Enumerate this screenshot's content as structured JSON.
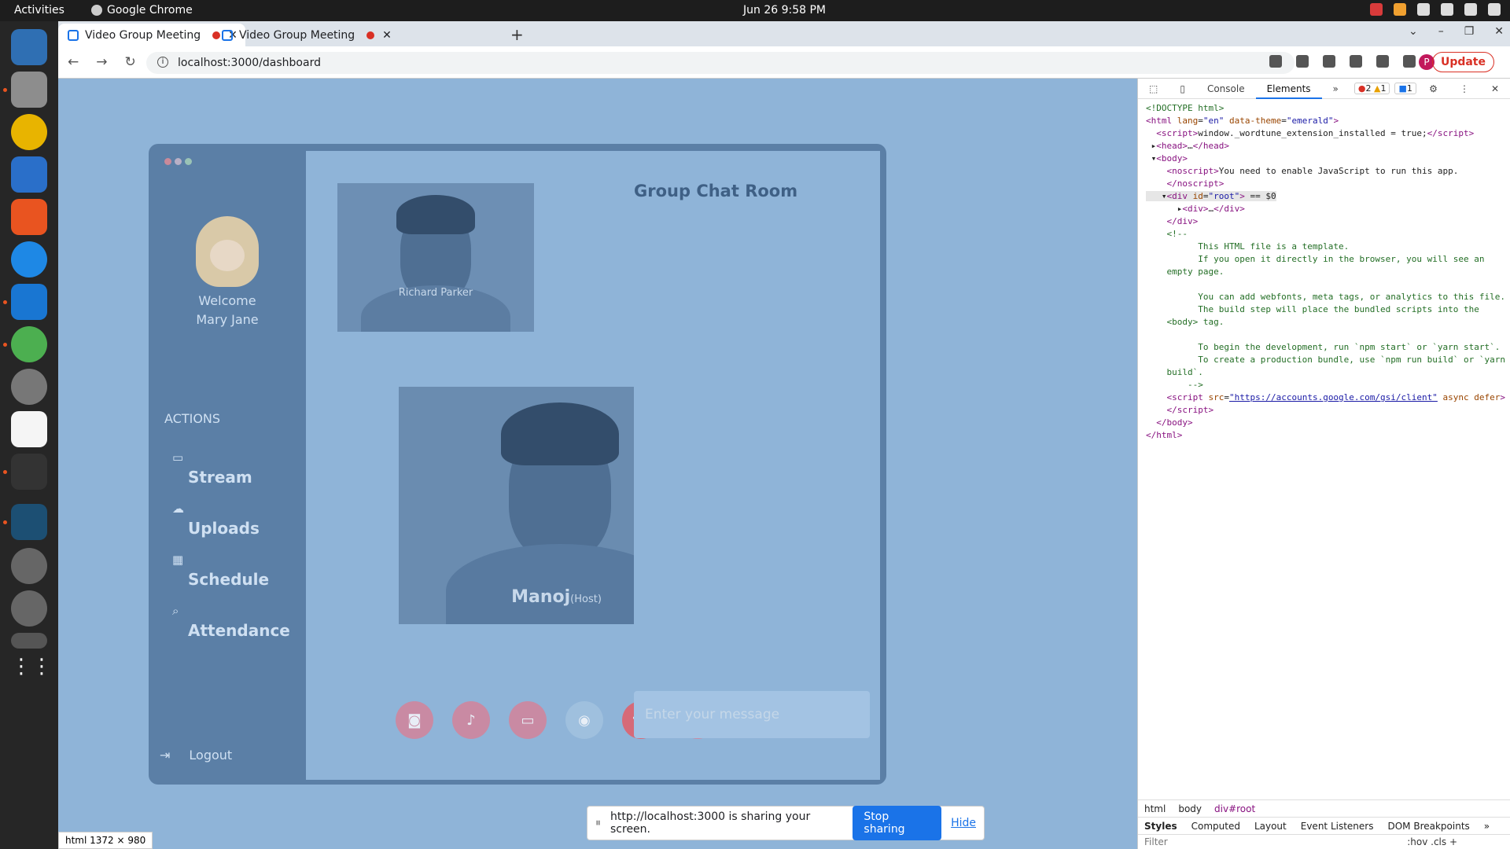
{
  "system": {
    "activities": "Activities",
    "app_name": "Google Chrome",
    "clock": "Jun 26  9:58 PM"
  },
  "browser": {
    "tabs": [
      {
        "title": "Video Group Meeting"
      },
      {
        "title": "Video Group Meeting"
      }
    ],
    "url": "localhost:3000/dashboard",
    "profile_initial": "P",
    "update_label": "Update"
  },
  "app": {
    "welcome": "Welcome",
    "user_name": "Mary Jane",
    "actions_heading": "ACTIONS",
    "nav": [
      {
        "label": "Stream"
      },
      {
        "label": "Uploads"
      },
      {
        "label": "Schedule"
      },
      {
        "label": "Attendance"
      }
    ],
    "logout": "Logout",
    "participant_name": "Richard Parker",
    "host_name": "Manoj",
    "host_tag": "(Host)",
    "chat_title": "Group Chat Room",
    "message_placeholder": "Enter your message"
  },
  "devtools": {
    "tabs": [
      "Console",
      "Elements"
    ],
    "errors": "2",
    "warnings": "1",
    "messages": "1",
    "breadcrumbs": [
      "html",
      "body",
      "div#root"
    ],
    "bottom_tabs": [
      "Styles",
      "Computed",
      "Layout",
      "Event Listeners",
      "DOM Breakpoints"
    ],
    "filter_placeholder": "Filter",
    "filter_tools": ":hov  .cls  +"
  },
  "overlay": {
    "element_size": "html  1372 × 980",
    "share_text": "http://localhost:3000 is sharing your screen.",
    "stop_label": "Stop sharing",
    "hide_label": "Hide"
  },
  "colors": {
    "frame": "#5b7fa6",
    "page_bg": "#8fb4d8",
    "accent_blue": "#1a73e8",
    "update_red": "#d93025",
    "end_call": "#d66a78"
  }
}
